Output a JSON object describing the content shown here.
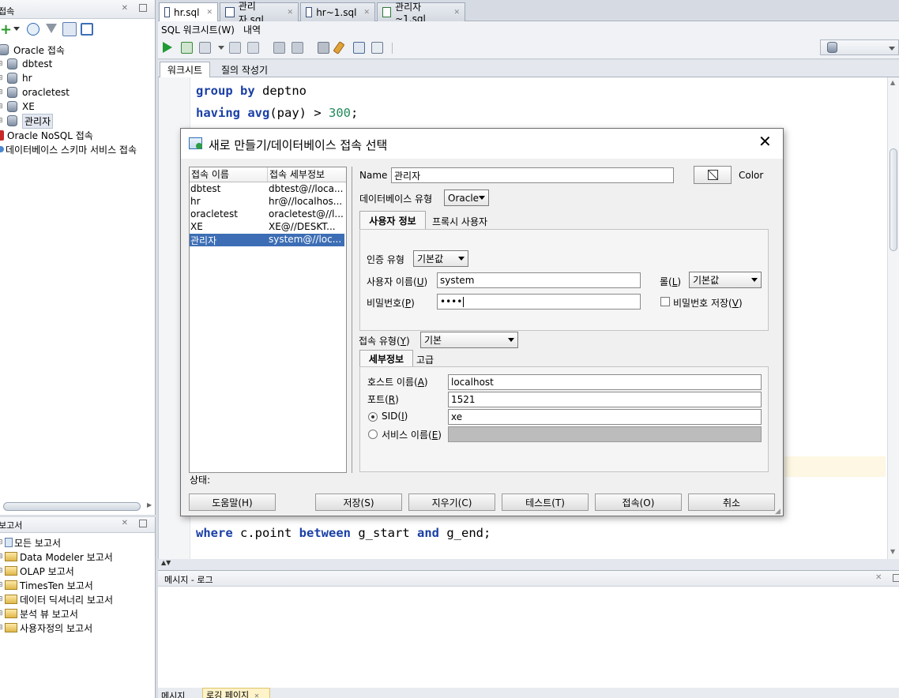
{
  "connections_pane": {
    "title": "접속",
    "tree": [
      {
        "label": "Oracle 접속",
        "type": "root"
      },
      {
        "label": "dbtest",
        "type": "db"
      },
      {
        "label": "hr",
        "type": "db"
      },
      {
        "label": "oracletest",
        "type": "db"
      },
      {
        "label": "XE",
        "type": "db"
      },
      {
        "label": "관리자",
        "type": "db"
      },
      {
        "label": "Oracle NoSQL 접속",
        "type": "root"
      },
      {
        "label": "데이터베이스 스키마 서비스 접속",
        "type": "root"
      }
    ]
  },
  "reports_pane": {
    "title": "보고서",
    "tree": [
      {
        "label": "모든 보고서"
      },
      {
        "label": "Data Modeler 보고서"
      },
      {
        "label": "OLAP 보고서"
      },
      {
        "label": "TimesTen 보고서"
      },
      {
        "label": "데이터 딕셔너리 보고서"
      },
      {
        "label": "분석 뷰 보고서"
      },
      {
        "label": "사용자정의 보고서"
      }
    ]
  },
  "file_tabs": [
    {
      "label": "hr.sql",
      "active": true
    },
    {
      "label": "관리자.sql",
      "active": false
    },
    {
      "label": "hr~1.sql",
      "active": false
    },
    {
      "label": "관리자~1.sql",
      "active": false
    }
  ],
  "editor_subtabs": [
    "SQL 워크시트(W)",
    "내역"
  ],
  "worksheet_tabs": [
    "워크시트",
    "질의 작성기"
  ],
  "code": {
    "line1_kw1": "group by",
    "line1_rest": " deptno",
    "line2_kw1": "having",
    "line2_kw2": "avg",
    "line2_mid": "(pay) > ",
    "line2_num": "300",
    "line2_end": ";",
    "line_last_kw1": "where",
    "line_last_mid1": " c.point ",
    "line_last_kw2": "between",
    "line_last_mid2": " g_start ",
    "line_last_kw3": "and",
    "line_last_end": " g_end;"
  },
  "messages_pane": {
    "title": "메시지 - 로그",
    "bottom_tabs": [
      "메시지",
      "로깅 페이지"
    ]
  },
  "dialog": {
    "title": "새로 만들기/데이터베이스 접속 선택",
    "list_headers": [
      "접속 이름",
      "접속 세부정보"
    ],
    "connections": [
      {
        "name": "dbtest",
        "detail": "dbtest@//loca...",
        "selected": false
      },
      {
        "name": "hr",
        "detail": "hr@//localhos...",
        "selected": false
      },
      {
        "name": "oracletest",
        "detail": "oracletest@//l...",
        "selected": false
      },
      {
        "name": "XE",
        "detail": "XE@//DESKT...",
        "selected": false
      },
      {
        "name": "관리자",
        "detail": "system@//loc...",
        "selected": true
      }
    ],
    "name_label": "Name",
    "name_value": "관리자",
    "color_label": "Color",
    "db_type_label": "데이터베이스 유형",
    "db_type_value": "Oracle",
    "tabs": [
      "사용자 정보",
      "프록시 사용자"
    ],
    "auth_type_label": "인증 유형",
    "auth_type_value": "기본값",
    "username_label": "사용자 이름(",
    "username_mnemonic": "U",
    "username_value": "system",
    "role_label": "롤(",
    "role_mnemonic": "L",
    "role_value": "기본값",
    "password_label": "비밀번호(",
    "password_mnemonic": "P",
    "password_value": "••••",
    "save_password_label": "비밀번호 저장(",
    "save_password_mnemonic": "V",
    "conn_type_label": "접속 유형(",
    "conn_type_mnemonic": "Y",
    "conn_type_value": "기본",
    "detail_tabs": [
      "세부정보",
      "고급"
    ],
    "host_label": "호스트 이름(",
    "host_mnemonic": "A",
    "host_value": "localhost",
    "port_label": "포트(",
    "port_mnemonic": "R",
    "port_value": "1521",
    "sid_label": "SID(",
    "sid_mnemonic": "I",
    "sid_value": "xe",
    "service_label": "서비스 이름(",
    "service_mnemonic": "E",
    "service_value": "",
    "status_label": "상태:",
    "buttons": {
      "help": "도움말(H)",
      "save": "저장(S)",
      "clear": "지우기(C)",
      "test": "테스트(T)",
      "connect": "접속(O)",
      "cancel": "취소"
    }
  },
  "colors": {
    "selection": "#3d6eb5",
    "keyword": "#1a3fa6",
    "number": "#218a5a"
  }
}
